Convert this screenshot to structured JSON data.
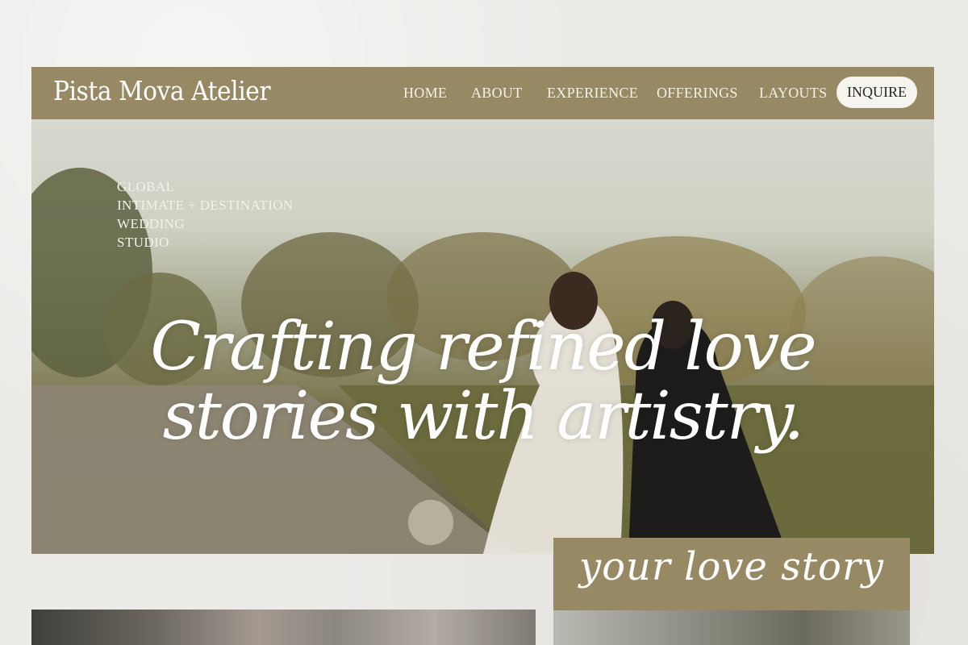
{
  "brand": {
    "name": "Pista Mova Atelier"
  },
  "nav": {
    "items": [
      {
        "label": "HOME"
      },
      {
        "label": "ABOUT"
      },
      {
        "label": "EXPERIENCE"
      },
      {
        "label": "OFFERINGS"
      },
      {
        "label": "LAYOUTS"
      }
    ],
    "cta_label": "INQUIRE"
  },
  "hero": {
    "tagline": [
      "GLOBAL",
      "INTIMATE + DESTINATION",
      "WEDDING",
      "STUDIO"
    ],
    "headline_line1": "Crafting refined love",
    "headline_line2": "stories with artistry."
  },
  "story_card": {
    "script": "your love story"
  },
  "colors": {
    "accent": "#978963",
    "background": "#ecebe8",
    "cta_background": "#f6f4ef",
    "text_light": "#ffffff"
  }
}
